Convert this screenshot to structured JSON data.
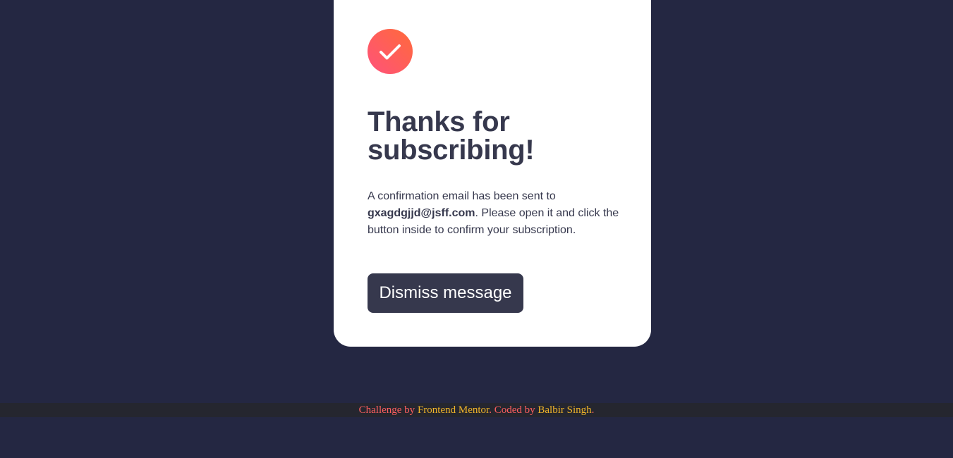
{
  "card": {
    "icon": "check-circle-icon",
    "title": "Thanks for subscribing!",
    "message": {
      "before": "A confirmation email has been sent to ",
      "email": "gxagdgjjd@jsff.com",
      "after": ". Please open it and click the button inside to confirm your subscription."
    },
    "dismiss_label": "Dismiss message"
  },
  "footer": {
    "challenge_text": "Challenge by ",
    "challenge_link": "Frontend Mentor",
    "coded_text": ". Coded by ",
    "author_link": "Balbir Singh",
    "end_text": "."
  },
  "colors": {
    "background": "#242742",
    "card": "#ffffff",
    "text": "#36384d",
    "button": "#36384d",
    "gradient_start": "#ff527b",
    "gradient_end": "#ff6a3a",
    "footer_text": "#ff5f5f",
    "footer_link": "#f0b429"
  }
}
